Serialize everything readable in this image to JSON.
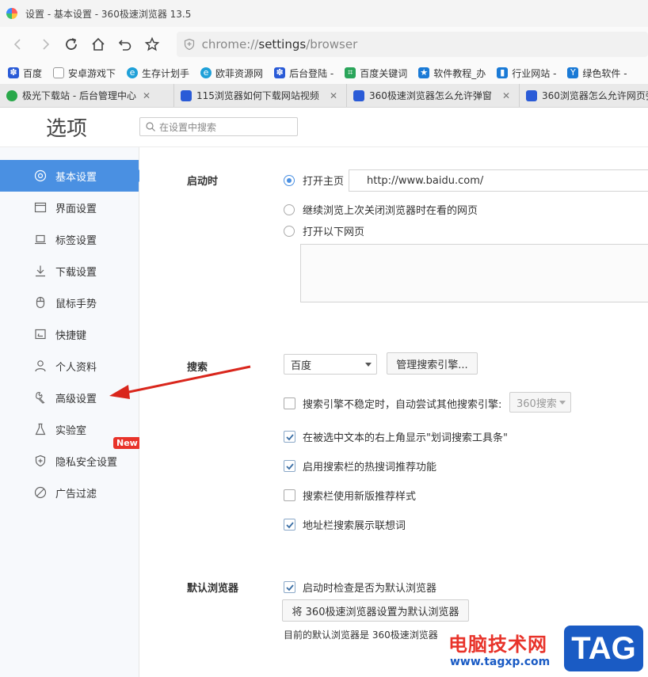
{
  "window": {
    "title": "设置 - 基本设置 - 360极速浏览器 13.5"
  },
  "nav": {
    "url_scheme": "chrome://",
    "url_host": "settings",
    "url_path": "/browser"
  },
  "bookmarks": [
    {
      "label": "百度",
      "icon": "baidu-paw-icon",
      "color": "#2a5bd7"
    },
    {
      "label": "安卓游戏下",
      "icon": "page-icon",
      "color": "#999999"
    },
    {
      "label": "生存计划手",
      "icon": "globe-icon",
      "color": "#1fa0d8"
    },
    {
      "label": "欧菲资源网",
      "icon": "globe-icon",
      "color": "#1fa0d8"
    },
    {
      "label": "后台登陆 -",
      "icon": "baidu-paw-icon",
      "color": "#2a5bd7"
    },
    {
      "label": "百度关键词",
      "icon": "crop-icon",
      "color": "#2aa55a"
    },
    {
      "label": "软件教程_办",
      "icon": "star-icon",
      "color": "#1a7ad6"
    },
    {
      "label": "行业网站 -",
      "icon": "chart-icon",
      "color": "#1a7ad6"
    },
    {
      "label": "绿色软件 -",
      "icon": "y-icon",
      "color": "#1a7ad6"
    }
  ],
  "tabs": [
    {
      "label": "极光下载站 - 后台管理中心",
      "color": "#29a84a"
    },
    {
      "label": "115浏览器如何下载网站视频",
      "color": "#2a5bd7"
    },
    {
      "label": "360极速浏览器怎么允许弹窗",
      "color": "#2a5bd7"
    },
    {
      "label": "360浏览器怎么允许网页弹",
      "color": "#2a5bd7"
    }
  ],
  "header": {
    "title": "选项",
    "search_placeholder": "在设置中搜索"
  },
  "sidebar": {
    "items": [
      {
        "label": "基本设置",
        "icon": "settings-circle-icon",
        "active": true
      },
      {
        "label": "界面设置",
        "icon": "window-icon"
      },
      {
        "label": "标签设置",
        "icon": "laptop-icon"
      },
      {
        "label": "下载设置",
        "icon": "download-icon"
      },
      {
        "label": "鼠标手势",
        "icon": "mouse-icon"
      },
      {
        "label": "快捷键",
        "icon": "keyboard-icon"
      },
      {
        "label": "个人资料",
        "icon": "user-icon"
      },
      {
        "label": "高级设置",
        "icon": "wrench-icon"
      },
      {
        "label": "实验室",
        "icon": "flask-icon"
      },
      {
        "label": "隐私安全设置",
        "icon": "shield-plus-icon",
        "badge": "New"
      },
      {
        "label": "广告过滤",
        "icon": "block-icon"
      }
    ]
  },
  "startup": {
    "label": "启动时",
    "opt_home": "打开主页",
    "home_url": "http://www.baidu.com/",
    "opt_continue": "继续浏览上次关闭浏览器时在看的网页",
    "opt_pages": "打开以下网页"
  },
  "search": {
    "label": "搜索",
    "engine": "百度",
    "manage_button": "管理搜索引擎...",
    "fallback_label": "搜索引擎不稳定时，自动尝试其他搜索引擎:",
    "fallback_engine": "360搜索",
    "opt_selection": "在被选中文本的右上角显示\"划词搜索工具条\"",
    "opt_hot": "启用搜索栏的热搜词推荐功能",
    "opt_new_style": "搜索栏使用新版推荐样式",
    "opt_address": "地址栏搜索展示联想词"
  },
  "default_browser": {
    "label": "默认浏览器",
    "check_label": "启动时检查是否为默认浏览器",
    "button": "将 360极速浏览器设置为默认浏览器",
    "status": "目前的默认浏览器是 360极速浏览器"
  },
  "watermark": {
    "cn": "电脑技术网",
    "url": "www.tagxp.com",
    "tag": "TAG"
  }
}
